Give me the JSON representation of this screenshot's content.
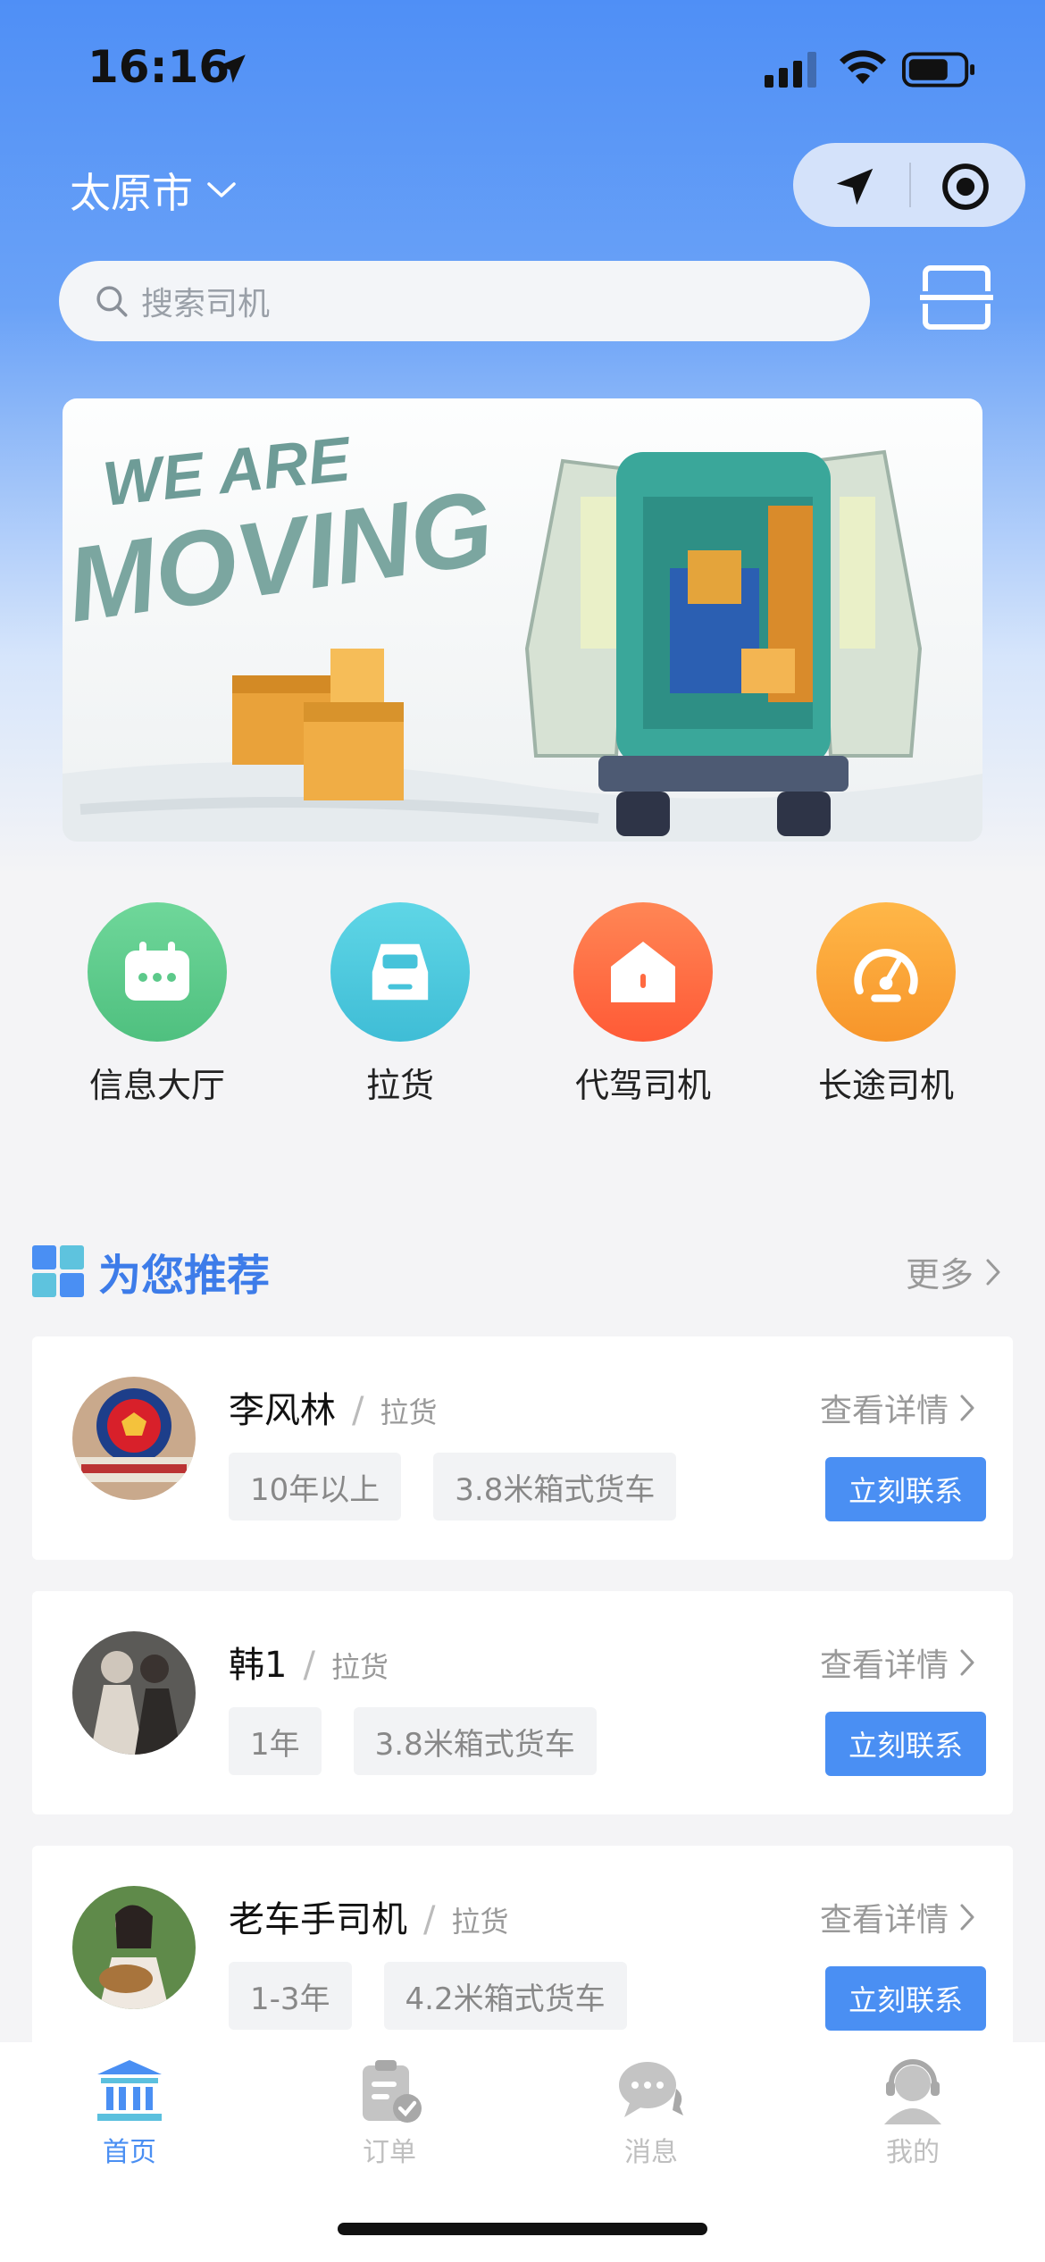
{
  "status_bar": {
    "time": "16:16"
  },
  "header": {
    "city": "太原市"
  },
  "search": {
    "placeholder": "搜索司机"
  },
  "banner": {
    "line1": "WE ARE",
    "line2": "MOVING"
  },
  "categories": [
    {
      "label": "信息大厅",
      "color": "#5fcf8c"
    },
    {
      "label": "拉货",
      "color": "#4dc8de"
    },
    {
      "label": "代驾司机",
      "color": "#ff6e45"
    },
    {
      "label": "长途司机",
      "color": "#fba63a"
    }
  ],
  "recommend": {
    "title": "为您推荐",
    "more": "更多",
    "items": [
      {
        "name": "李风林",
        "category": "拉货",
        "tags": [
          "10年以上",
          "3.8米箱式货车"
        ],
        "detail": "查看详情",
        "contact": "立刻联系"
      },
      {
        "name": "韩1",
        "category": "拉货",
        "tags": [
          "1年",
          "3.8米箱式货车"
        ],
        "detail": "查看详情",
        "contact": "立刻联系"
      },
      {
        "name": "老车手司机",
        "category": "拉货",
        "tags": [
          "1-3年",
          "4.2米箱式货车"
        ],
        "detail": "查看详情",
        "contact": "立刻联系"
      }
    ]
  },
  "tabbar": {
    "items": [
      {
        "label": "首页",
        "active": true
      },
      {
        "label": "订单",
        "active": false
      },
      {
        "label": "消息",
        "active": false
      },
      {
        "label": "我的",
        "active": false
      }
    ],
    "active_color": "#4a8ff3",
    "inactive_color": "#bfbfbf"
  }
}
